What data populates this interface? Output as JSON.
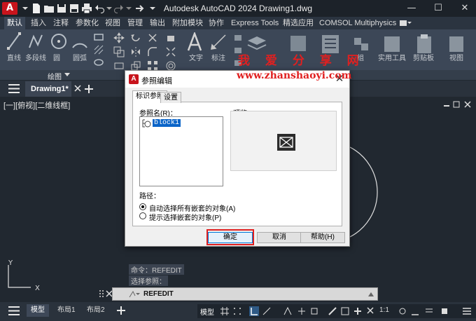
{
  "app": {
    "logo_letter": "A",
    "title": "Autodesk AutoCAD 2024    Drawing1.dwg",
    "window_controls": [
      "—",
      "☐",
      "✕"
    ]
  },
  "ribbon": {
    "tabs": [
      "默认",
      "插入",
      "注释",
      "参数化",
      "视图",
      "管理",
      "输出",
      "附加模块",
      "协作",
      "Express Tools",
      "精选应用",
      "COMSOL Multiphysics"
    ],
    "active_tab": "默认",
    "tools": [
      "直线",
      "多段线",
      "圆",
      "圆弧",
      "文字",
      "标注",
      "组",
      "实用工具",
      "剪贴板",
      "视图"
    ],
    "panel_label": "绘图"
  },
  "drawing": {
    "tab": "Drawing1*",
    "view_label": "[一][俯视][二维线框]"
  },
  "dialog": {
    "title": "参照编辑",
    "close": "✕",
    "tabs": [
      "标识参照",
      "设置"
    ],
    "ref_name_label": "参照名(R)：",
    "ref_item": "block1",
    "preview_label": "预览",
    "path_label": "路径：",
    "radio_auto": "自动选择所有嵌套的对象(A)",
    "radio_prompt": "提示选择嵌套的对象(P)",
    "ok": "确定",
    "cancel": "取消",
    "help": "帮助(H)"
  },
  "watermark": {
    "line1": "我 爱 分 享 网",
    "line2": "www.zhanshaoyi.com"
  },
  "command": {
    "history1": "命令：REFEDIT",
    "history2": "选择参照：",
    "current": "REFEDIT"
  },
  "status": {
    "layout_tabs": [
      "模型",
      "布局1",
      "布局2"
    ],
    "model_button": "模型",
    "scale": "1:1"
  },
  "ucs": {
    "y": "Y",
    "x": "X"
  }
}
